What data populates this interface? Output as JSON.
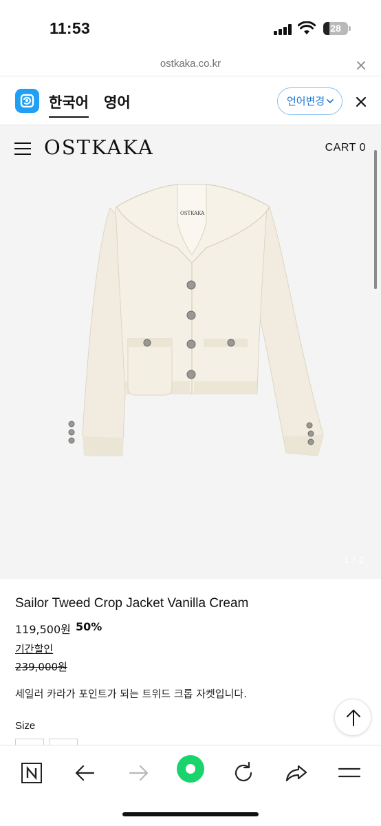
{
  "status_bar": {
    "time": "11:53",
    "battery": "28"
  },
  "browser": {
    "url": "ostkaka.co.kr"
  },
  "translate_bar": {
    "tab_korean": "한국어",
    "tab_english": "영어",
    "change_button": "언어변경"
  },
  "site": {
    "logo": "OSTKAKA",
    "cart": "CART 0"
  },
  "product": {
    "image_counter": "1 / 2",
    "label_text": "OSTKAKA",
    "name": "Sailor Tweed Crop Jacket Vanilla Cream",
    "price": "119,500원",
    "discount": "50%",
    "period_sale": "기간할인",
    "original_price": "239,000원",
    "description": "세일러 카라가 포인트가 되는 트위드 크롭 자켓입니다.",
    "size_label": "Size"
  },
  "colors": {
    "accent_blue": "#1a76d2",
    "papago_blue": "#1fa0f5",
    "record_green": "#19d46c",
    "background_gray": "#f4f4f4"
  },
  "icons": {
    "top_button": "arrow-up-icon",
    "toolbar": [
      "naver-n-icon",
      "back-arrow-icon",
      "forward-arrow-icon",
      "green-dot-icon",
      "refresh-icon",
      "share-icon",
      "menu-icon"
    ]
  }
}
